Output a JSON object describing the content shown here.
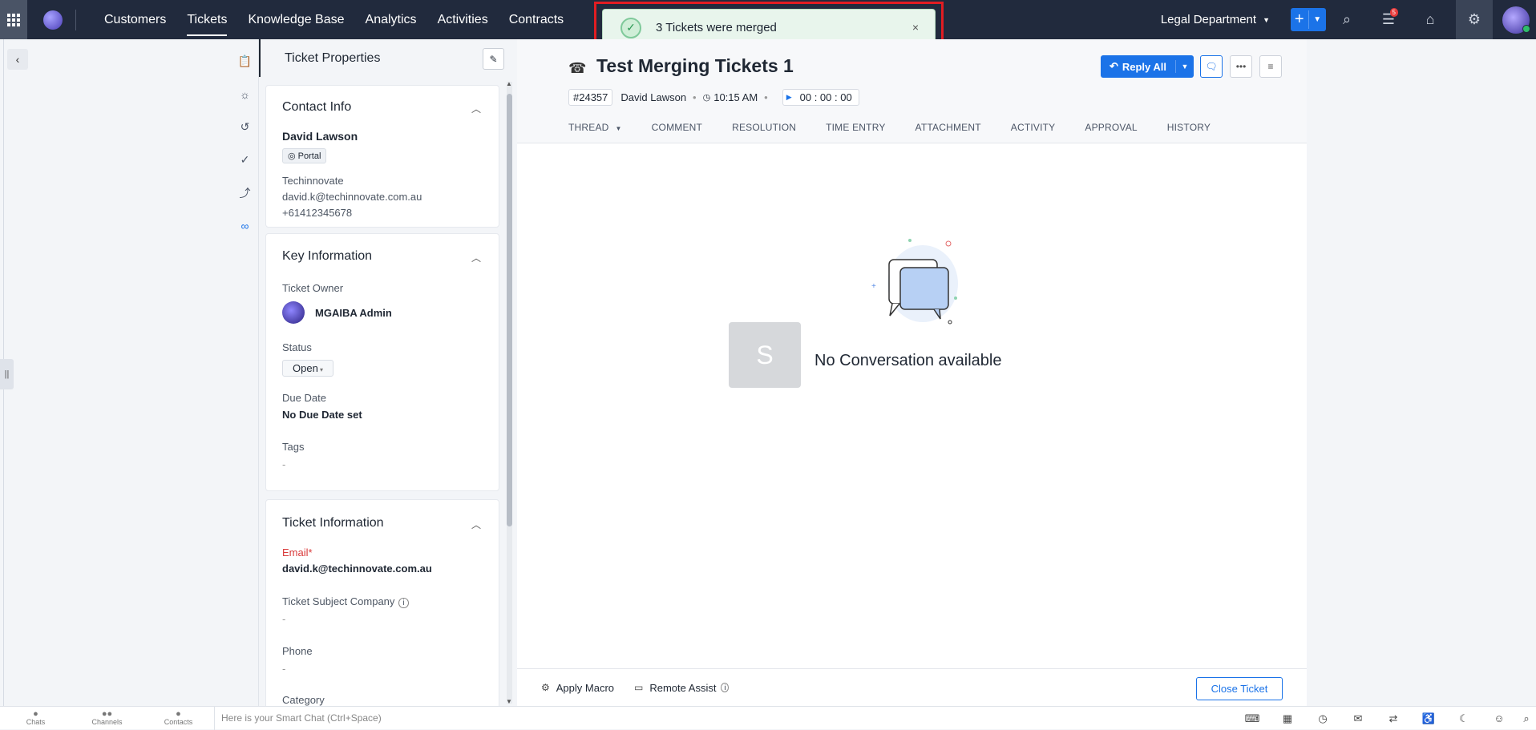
{
  "nav": {
    "items": [
      "Customers",
      "Tickets",
      "Knowledge Base",
      "Analytics",
      "Activities",
      "Contracts"
    ],
    "active": "Tickets"
  },
  "toast": {
    "message": "3 Tickets were merged",
    "close": "×"
  },
  "topright": {
    "department": "Legal Department",
    "notification_count": "5"
  },
  "properties": {
    "title": "Ticket Properties",
    "contact": {
      "heading": "Contact Info",
      "name": "David Lawson",
      "channel": "Portal",
      "company": "Techinnovate",
      "email": "david.k@techinnovate.com.au",
      "phone": "+61412345678"
    },
    "key": {
      "heading": "Key Information",
      "owner_label": "Ticket Owner",
      "owner": "MGAIBA Admin",
      "status_label": "Status",
      "status": "Open",
      "due_label": "Due Date",
      "due": "No Due Date set",
      "tags_label": "Tags",
      "tags": "-"
    },
    "ticket": {
      "heading": "Ticket Information",
      "email_label": "Email",
      "email_req": "*",
      "email": "david.k@techinnovate.com.au",
      "company_label": "Ticket Subject Company",
      "company": "-",
      "phone_label": "Phone",
      "phone": "-",
      "category_label": "Category"
    }
  },
  "ticket": {
    "title": "Test Merging Tickets 1",
    "id": "#24357",
    "contact": "David Lawson",
    "time": "10:15 AM",
    "timer": "00 : 00 : 00",
    "reply": "Reply All"
  },
  "tabs": [
    "THREAD",
    "COMMENT",
    "RESOLUTION",
    "TIME ENTRY",
    "ATTACHMENT",
    "ACTIVITY",
    "APPROVAL",
    "HISTORY"
  ],
  "conversation": {
    "avatar_letter": "S",
    "empty": "No Conversation available"
  },
  "footer": {
    "macro": "Apply Macro",
    "remote": "Remote Assist",
    "close": "Close Ticket"
  },
  "bottombar": {
    "chats": "Chats",
    "channels": "Channels",
    "contacts": "Contacts",
    "smartchat": "Here is your Smart Chat (Ctrl+Space)"
  }
}
